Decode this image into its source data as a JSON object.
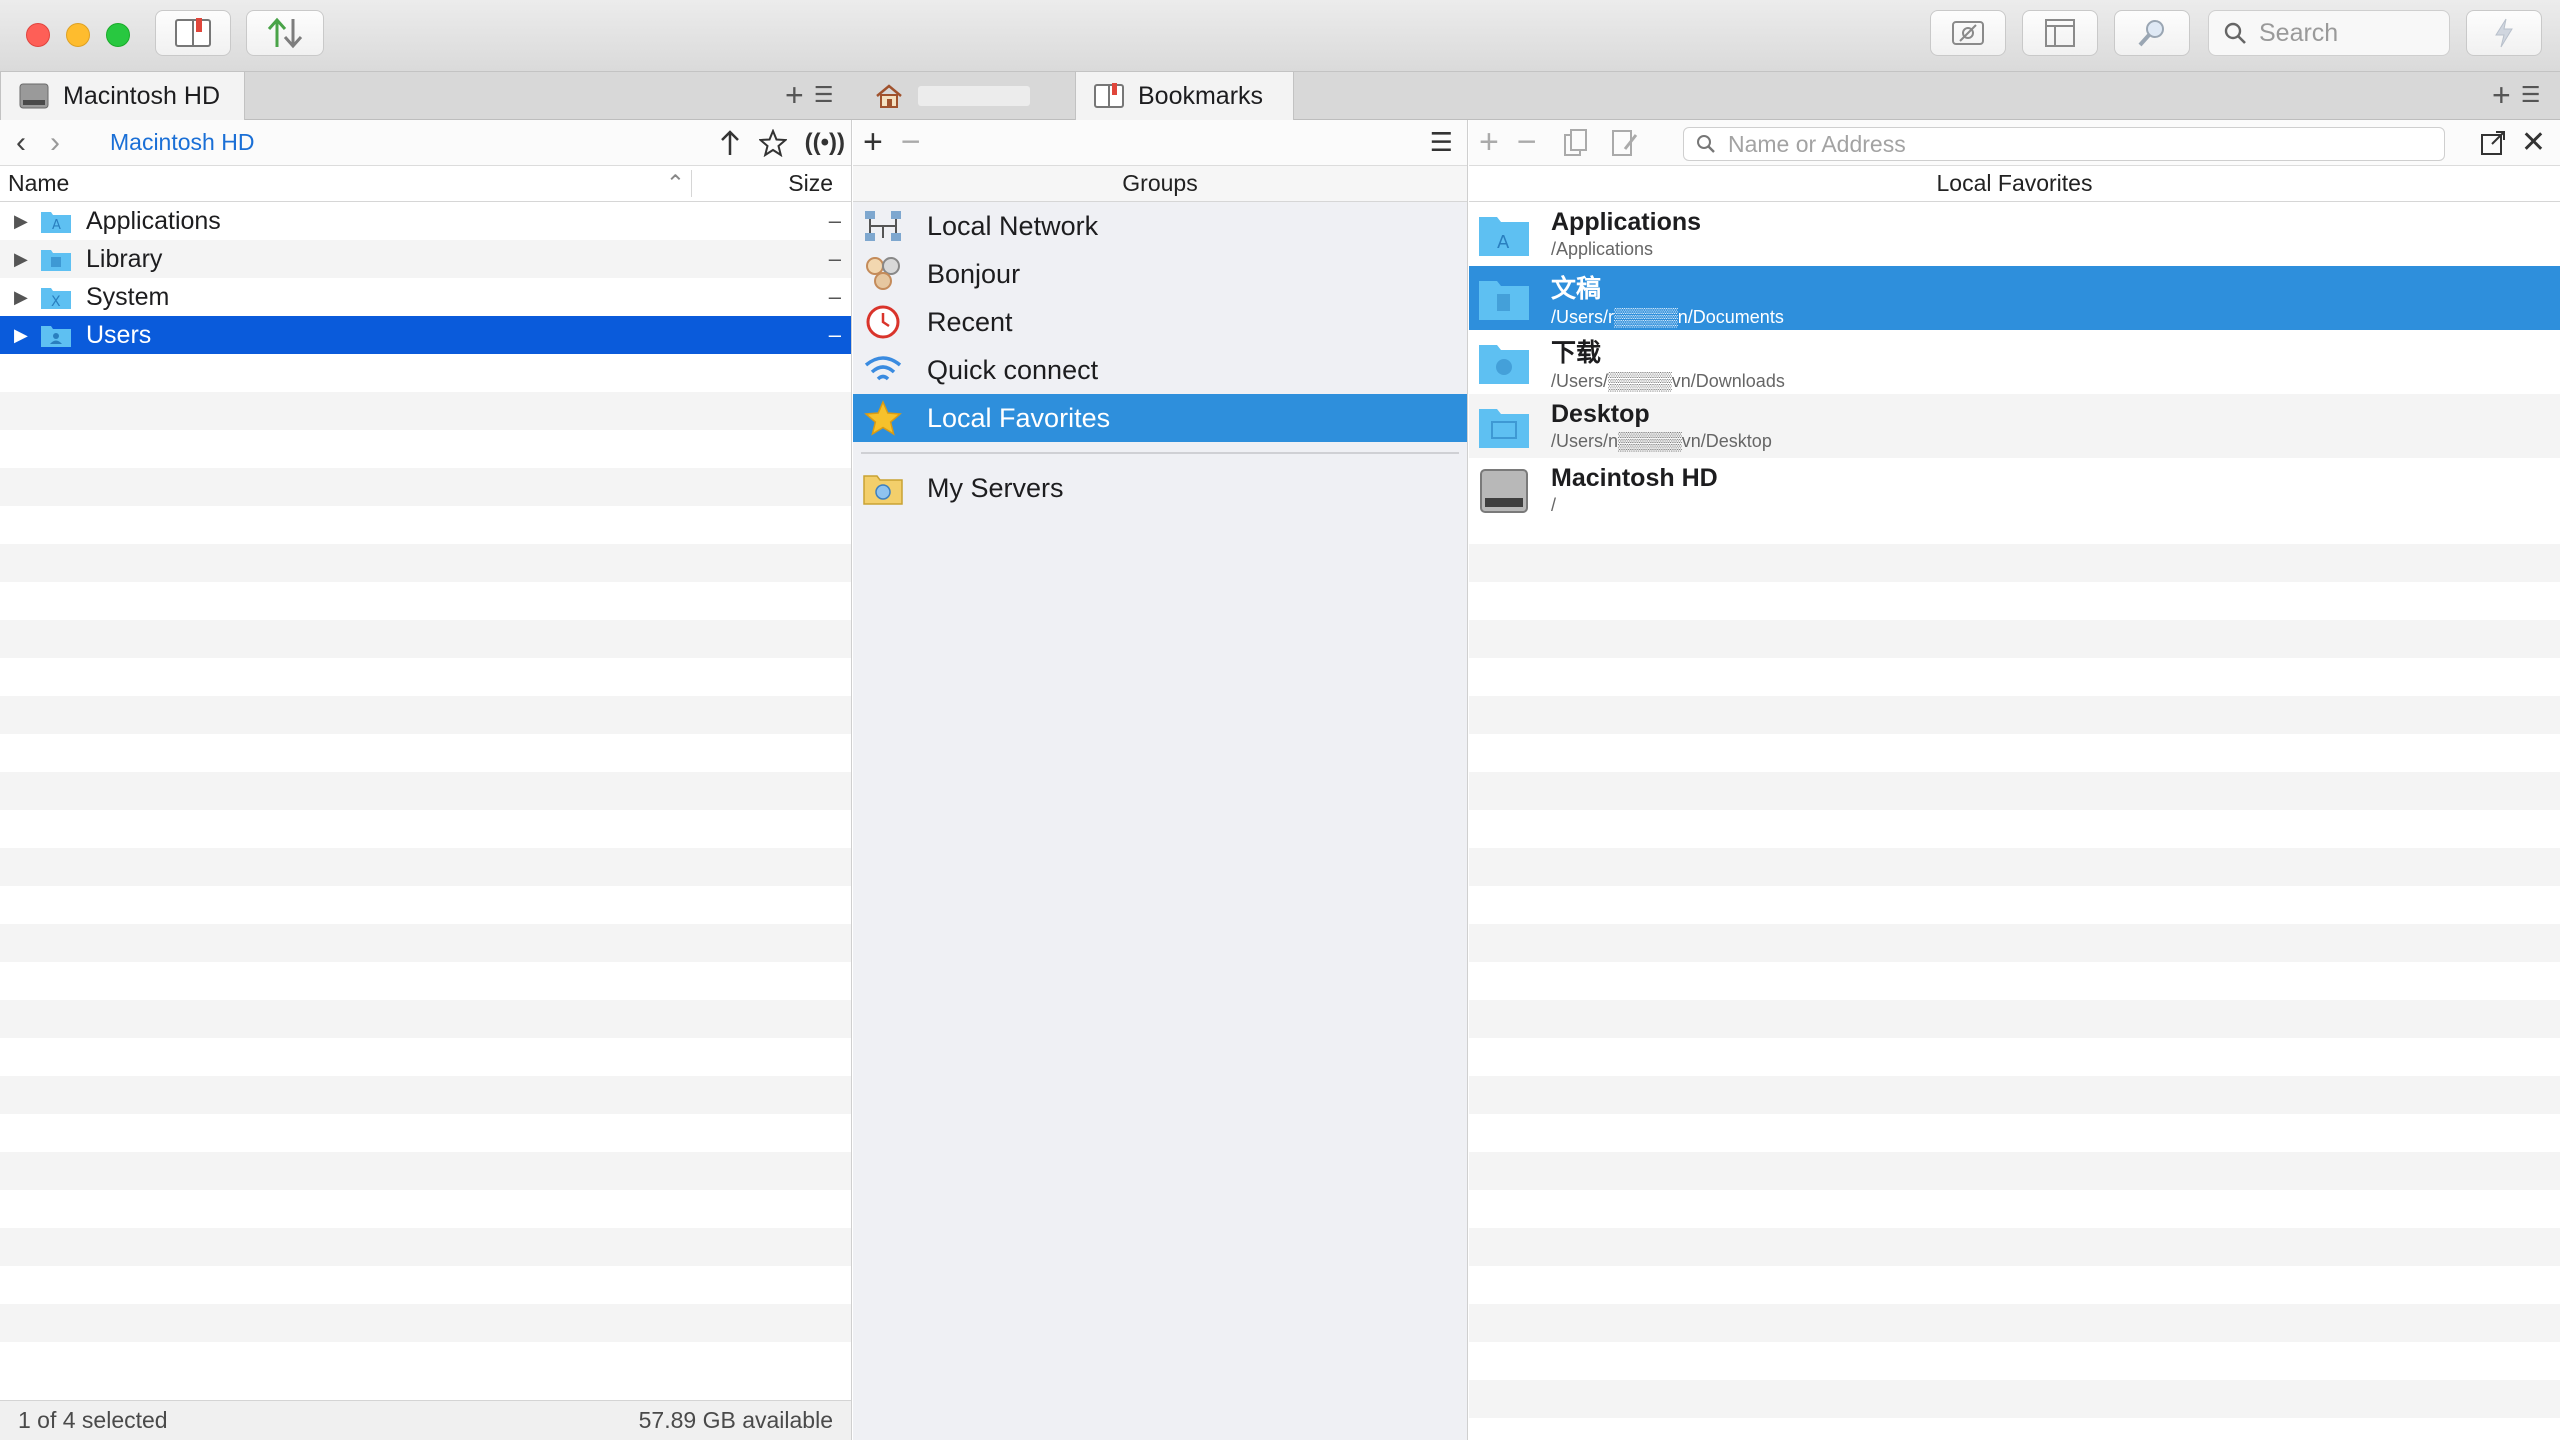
{
  "search": {
    "placeholder": "Search"
  },
  "tabs": {
    "left": {
      "label": "Macintosh HD"
    },
    "home": {
      "label": ""
    },
    "bookmarks": {
      "label": "Bookmarks"
    }
  },
  "left_pane": {
    "breadcrumb": "Macintosh HD",
    "columns": {
      "name": "Name",
      "size": "Size"
    },
    "rows": [
      {
        "name": "Applications",
        "size": "–"
      },
      {
        "name": "Library",
        "size": "–"
      },
      {
        "name": "System",
        "size": "–"
      },
      {
        "name": "Users",
        "size": "–"
      }
    ],
    "status_left": "1 of 4 selected",
    "status_right": "57.89 GB available"
  },
  "groups": {
    "header": "Groups",
    "items": [
      {
        "label": "Local Network",
        "icon": "network-icon"
      },
      {
        "label": "Bonjour",
        "icon": "bonjour-icon"
      },
      {
        "label": "Recent",
        "icon": "clock-icon"
      },
      {
        "label": "Quick connect",
        "icon": "wifi-icon"
      },
      {
        "label": "Local Favorites",
        "icon": "star-icon"
      },
      {
        "label": "My Servers",
        "icon": "server-folder-icon"
      }
    ]
  },
  "favorites": {
    "header": "Local Favorites",
    "search_placeholder": "Name or Address",
    "items": [
      {
        "title": "Applications",
        "path": "/Applications"
      },
      {
        "title": "文稿",
        "path": "/Users/r▒▒▒▒▒n/Documents"
      },
      {
        "title": "下载",
        "path": "/Users/▒▒▒▒▒vn/Downloads"
      },
      {
        "title": "Desktop",
        "path": "/Users/n▒▒▒▒▒vn/Desktop"
      },
      {
        "title": "Macintosh HD",
        "path": "/"
      }
    ]
  },
  "colors": {
    "selection_blue": "#0a5bdb",
    "highlight_blue": "#2e8fdc",
    "folder_blue": "#5ec0f2"
  }
}
